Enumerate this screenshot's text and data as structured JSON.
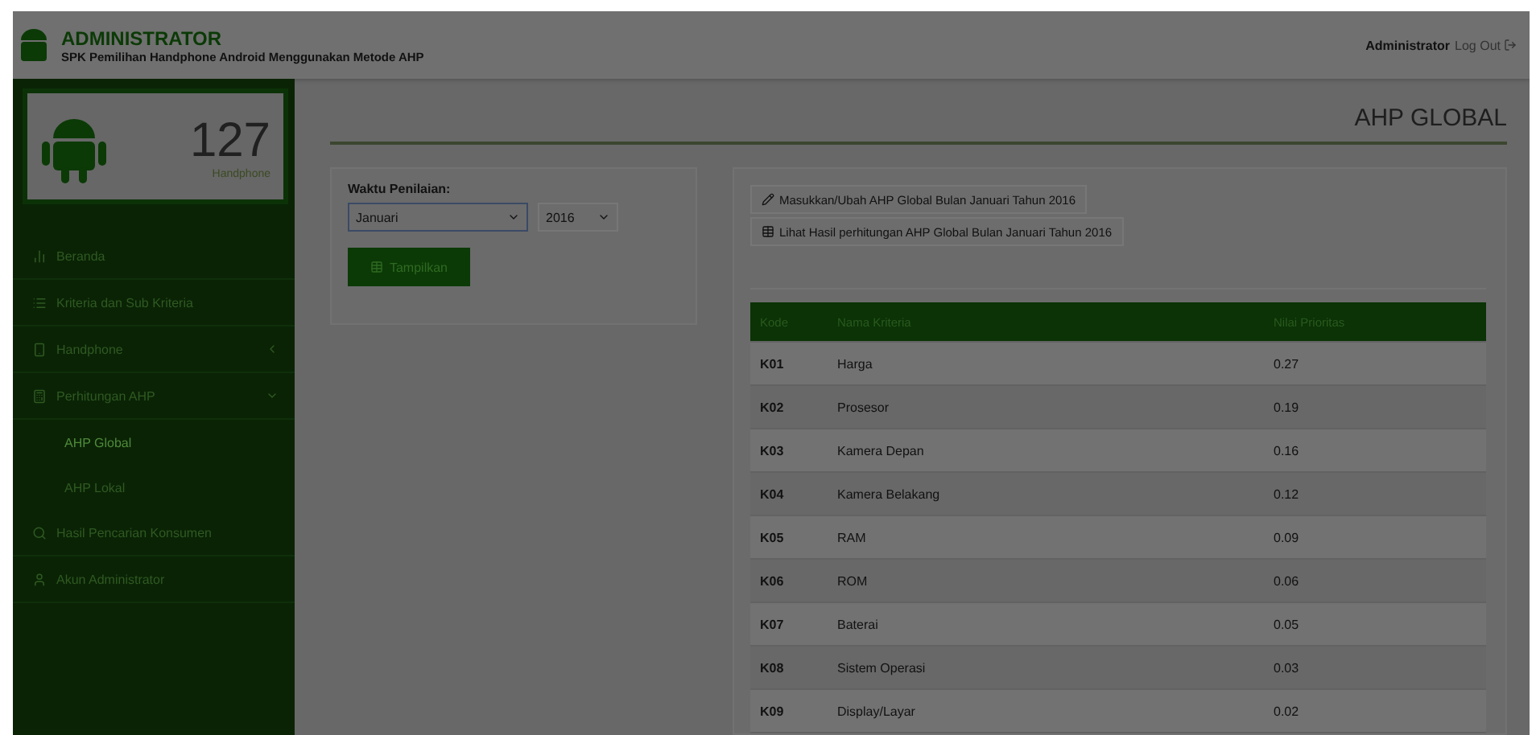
{
  "header": {
    "title": "ADMINISTRATOR",
    "subtitle": "SPK Pemilihan Handphone Android Menggunakan Metode AHP",
    "user": "Administrator",
    "logout": "Log Out"
  },
  "stat": {
    "count": "127",
    "label": "Handphone"
  },
  "sidebar": {
    "items": [
      {
        "label": "Beranda"
      },
      {
        "label": "Kriteria dan Sub Kriteria"
      },
      {
        "label": "Handphone",
        "expanded": false
      },
      {
        "label": "Perhitungan AHP",
        "expanded": true,
        "children": [
          {
            "label": "AHP Global",
            "selected": true
          },
          {
            "label": "AHP Lokal",
            "selected": false
          }
        ]
      },
      {
        "label": "Hasil Pencarian Konsumen"
      },
      {
        "label": "Akun Administrator"
      }
    ]
  },
  "page_title": "AHP GLOBAL",
  "filter": {
    "label": "Waktu Penilaian:",
    "month": "Januari",
    "year": "2016",
    "button": "Tampilkan"
  },
  "actions": [
    {
      "label": "Masukkan/Ubah AHP Global Bulan Januari Tahun 2016"
    },
    {
      "label": "Lihat Hasil perhitungan AHP Global Bulan Januari Tahun 2016"
    }
  ],
  "table": {
    "columns": [
      "Kode",
      "Nama Kriteria",
      "Nilai Prioritas"
    ],
    "rows": [
      [
        "K01",
        "Harga",
        "0.27"
      ],
      [
        "K02",
        "Prosesor",
        "0.19"
      ],
      [
        "K03",
        "Kamera Depan",
        "0.16"
      ],
      [
        "K04",
        "Kamera Belakang",
        "0.12"
      ],
      [
        "K05",
        "RAM",
        "0.09"
      ],
      [
        "K06",
        "ROM",
        "0.06"
      ],
      [
        "K07",
        "Baterai",
        "0.05"
      ],
      [
        "K08",
        "Sistem Operasi",
        "0.03"
      ],
      [
        "K09",
        "Display/Layar",
        "0.02"
      ]
    ]
  }
}
